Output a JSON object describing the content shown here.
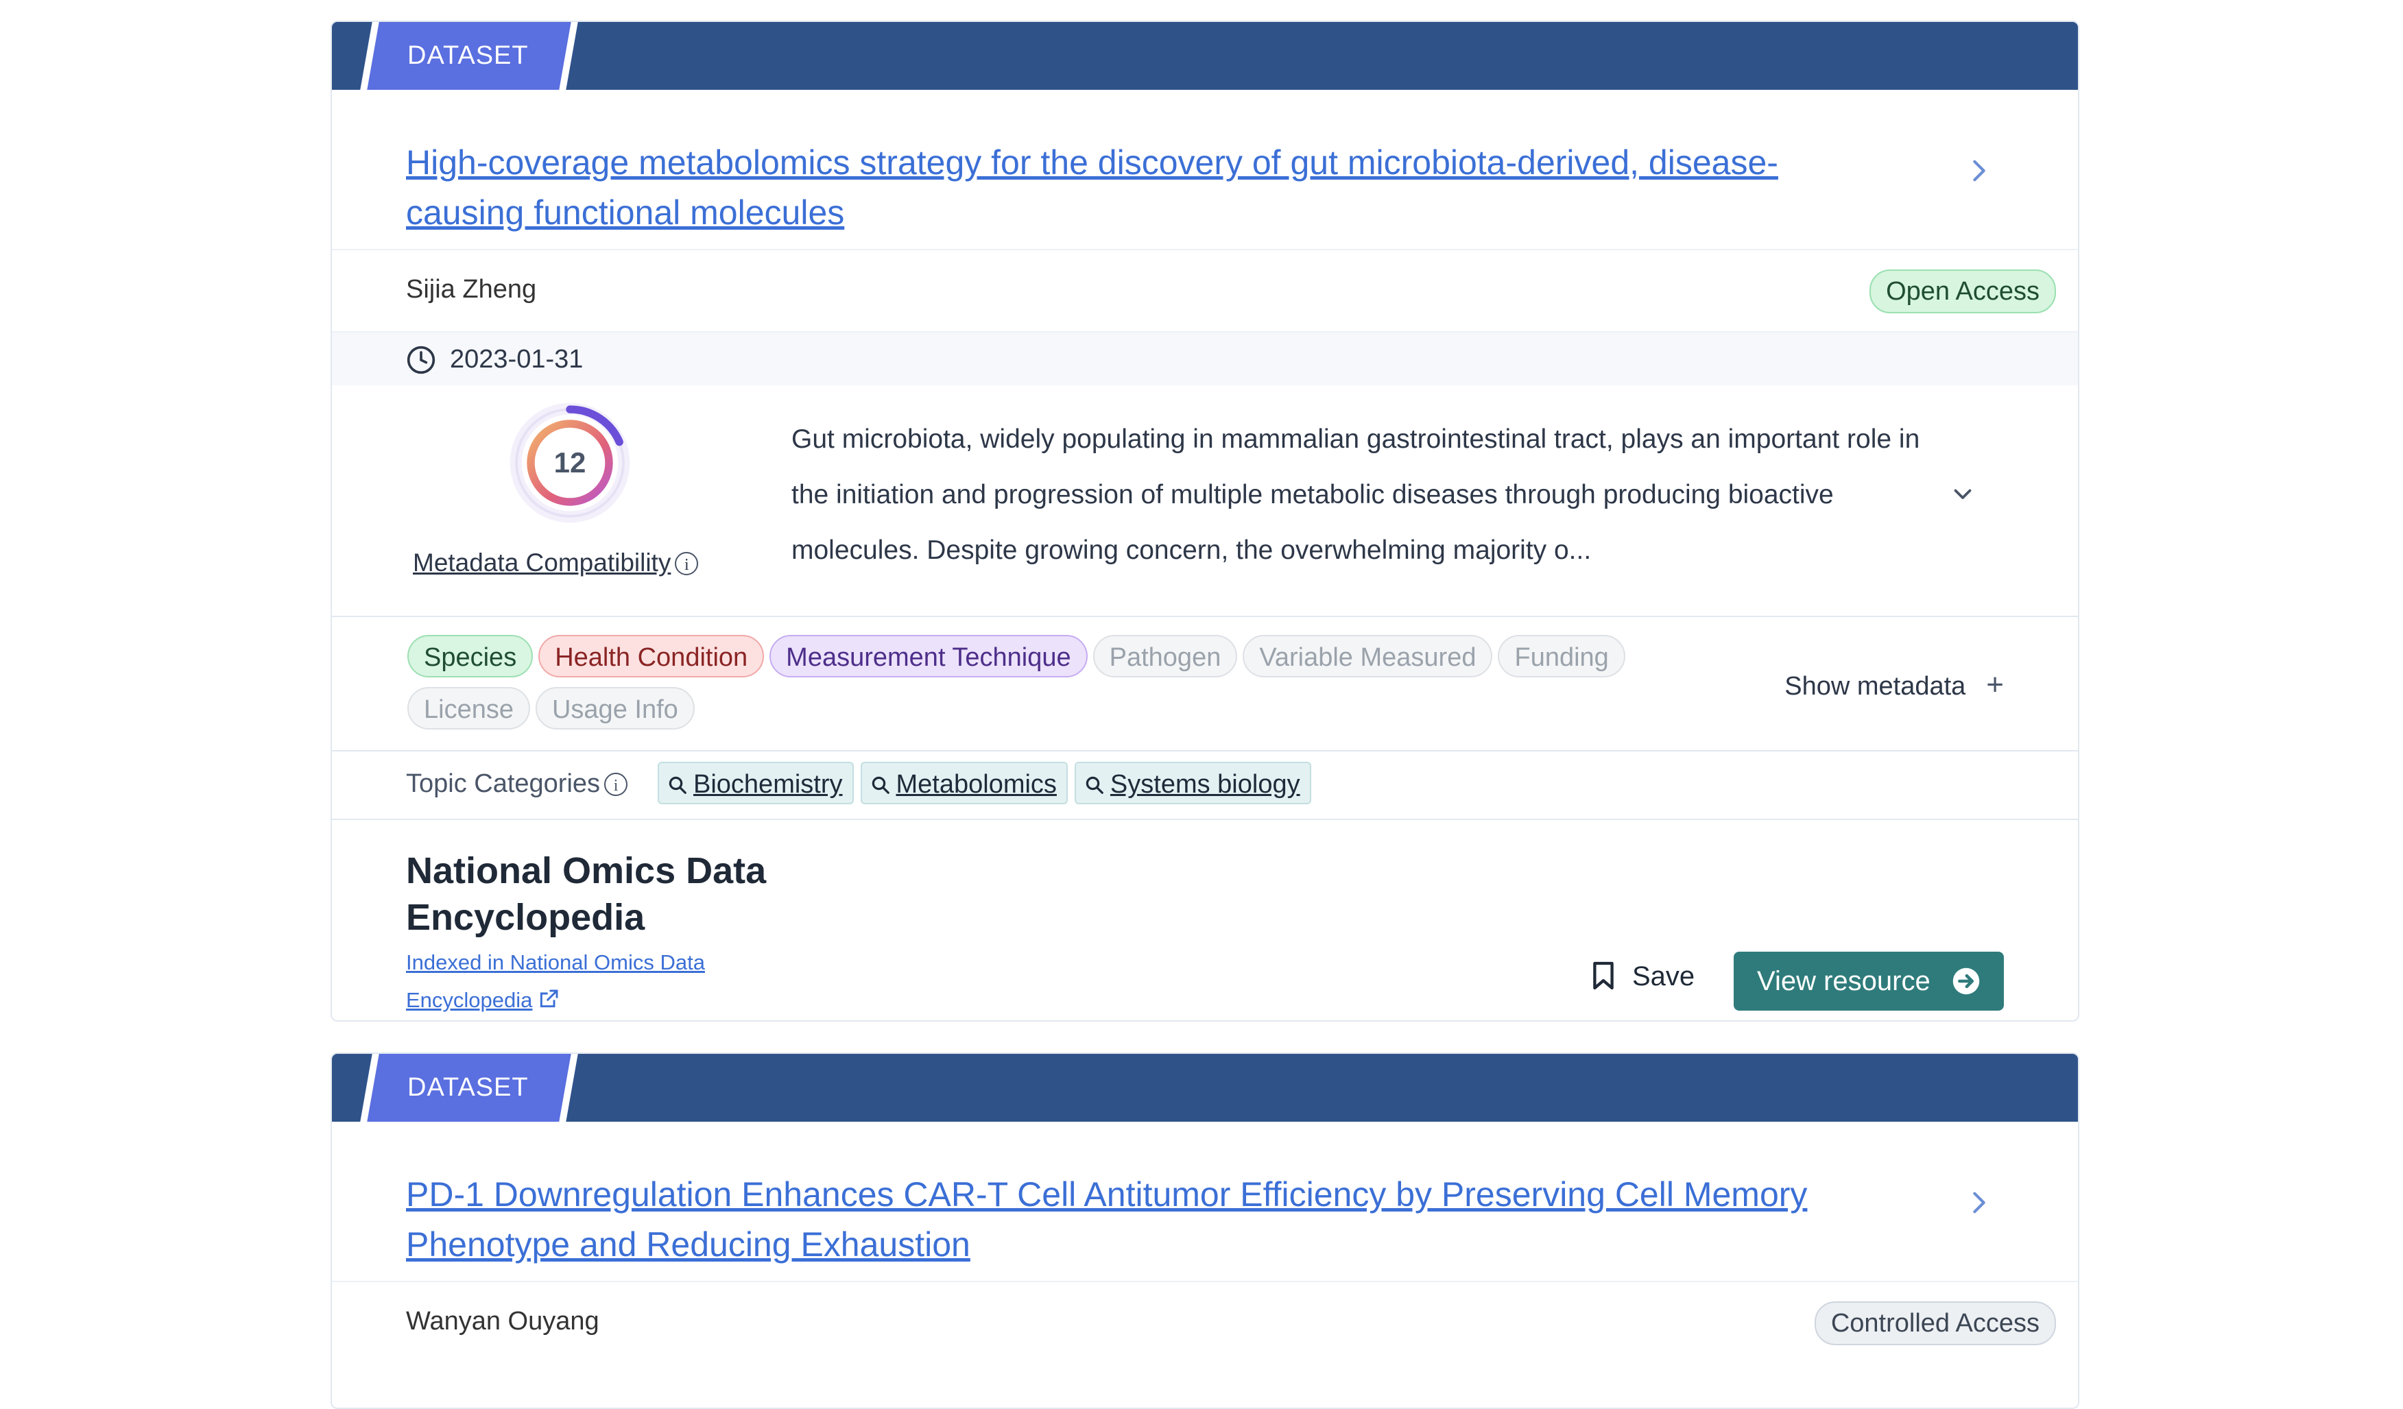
{
  "results": [
    {
      "type_label": "DATASET",
      "title": "High-coverage metabolomics strategy for the discovery of gut microbiota-derived, disease-causing functional molecules",
      "author": "Sijia Zheng",
      "access": "Open Access",
      "date": "2023-01-31",
      "compatibility_score": "12",
      "compatibility_label": "Metadata Compatibility",
      "description": "Gut microbiota, widely populating in mammalian gastrointestinal tract, plays an important role in the initiation and progression of multiple metabolic diseases through producing bioactive molecules. Despite growing concern, the overwhelming majority o...",
      "metadata_chips": [
        "Species",
        "Health Condition",
        "Measurement Technique",
        "Pathogen",
        "Variable Measured",
        "Funding",
        "License",
        "Usage Info"
      ],
      "show_metadata_label": "Show metadata",
      "topic_categories_label": "Topic Categories",
      "topics": [
        "Biochemistry",
        "Metabolomics",
        "Systems biology"
      ],
      "source_name": "National Omics Data Encyclopedia",
      "source_link": "Indexed in National Omics Data Encyclopedia",
      "save_label": "Save",
      "view_label": "View resource"
    },
    {
      "type_label": "DATASET",
      "title": "PD-1 Downregulation Enhances CAR-T Cell Antitumor Efficiency by Preserving Cell Memory Phenotype and Reducing Exhaustion",
      "author": "Wanyan Ouyang",
      "access": "Controlled Access"
    }
  ],
  "colors": {
    "banner": "#2f5389",
    "tag": "#5a6fe0",
    "link": "#3b6fd6",
    "view_button": "#2f7b7b"
  }
}
